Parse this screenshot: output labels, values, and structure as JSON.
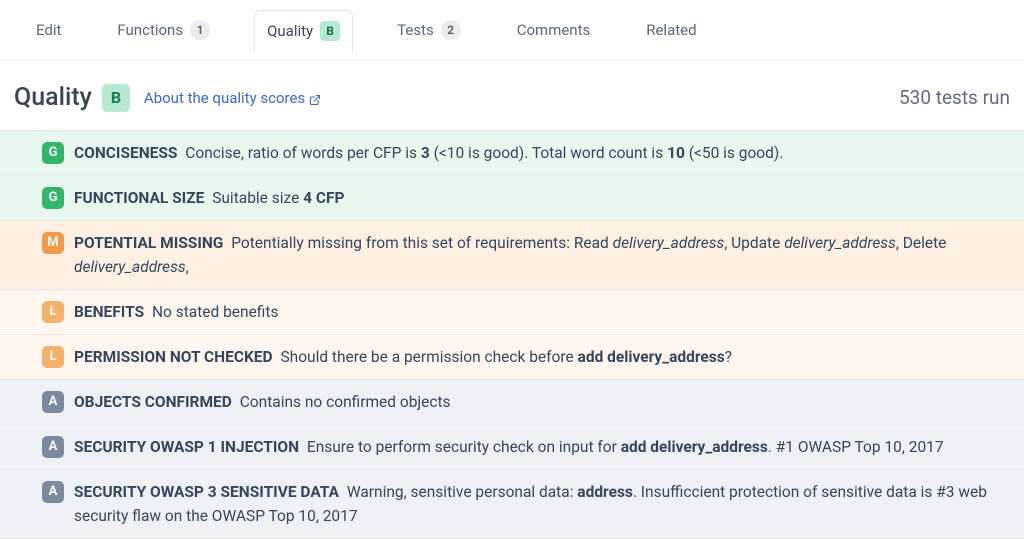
{
  "tabs": {
    "edit": "Edit",
    "functions": "Functions",
    "functions_count": "1",
    "quality": "Quality",
    "quality_grade": "B",
    "tests": "Tests",
    "tests_count": "2",
    "comments": "Comments",
    "related": "Related"
  },
  "header": {
    "title": "Quality",
    "grade": "B",
    "about_link": "About the quality scores",
    "tests_run": "530 tests run"
  },
  "rows": [
    {
      "sev": "G",
      "cat": "CONCISENESS",
      "html": "Concise, ratio of words per CFP is <b>3</b> (<10 is good). Total word count is <b>10</b> (<50 is good)."
    },
    {
      "sev": "G",
      "cat": "FUNCTIONAL SIZE",
      "html": "Suitable size <b>4 CFP</b>"
    },
    {
      "sev": "M",
      "cat": "POTENTIAL MISSING",
      "html": "Potentially missing from this set of requirements: Read <i>delivery_address</i>, Update <i>delivery_address</i>, Delete <i>delivery_address</i>,"
    },
    {
      "sev": "L",
      "cat": "BENEFITS",
      "html": "No stated benefits"
    },
    {
      "sev": "L",
      "cat": "PERMISSION NOT CHECKED",
      "html": "Should there be a permission check before <b>add delivery_address</b>?"
    },
    {
      "sev": "A",
      "cat": "OBJECTS CONFIRMED",
      "html": "Contains no confirmed objects"
    },
    {
      "sev": "A",
      "cat": "SECURITY OWASP 1 INJECTION",
      "html": "Ensure to perform security check on input for <b>add delivery_address</b>. #1 OWASP Top 10, 2017"
    },
    {
      "sev": "A",
      "cat": "SECURITY OWASP 3 SENSITIVE DATA",
      "html": "Warning, sensitive personal data: <b>address</b>. Insufficcient protection of sensitive data is #3 web security flaw on the OWASP Top 10, 2017"
    }
  ]
}
